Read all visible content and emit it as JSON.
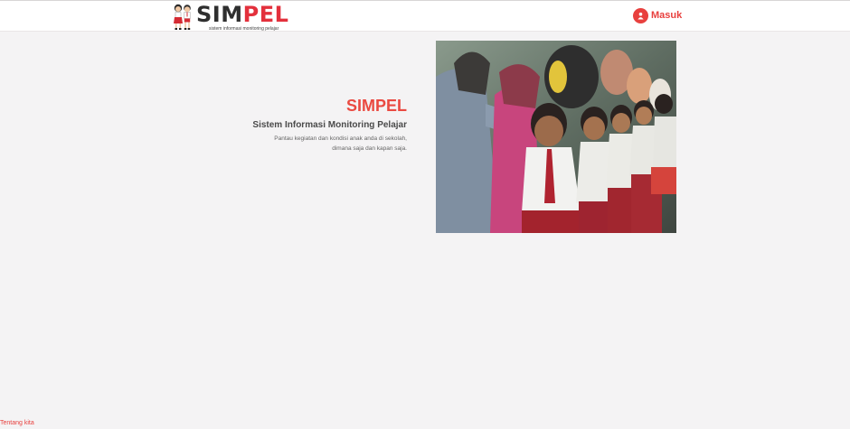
{
  "header": {
    "logo_sim": "SIM",
    "logo_pel": "PEL",
    "logo_tagline": "sistem informasi monitoring pelajar",
    "login_label": "Masuk"
  },
  "hero": {
    "title": "SIMPEL",
    "subtitle": "Sistem Informasi Monitoring Pelajar",
    "desc_line1": "Pantau kegiatan dan kondisi anak anda di sekolah,",
    "desc_line2": "dimana saja dan kapan saja."
  },
  "footer": {
    "link": "Tentang kita"
  },
  "colors": {
    "accent": "#e8403e",
    "background": "#f4f3f4",
    "header": "#ffffff"
  },
  "icons": {
    "login": "user-icon",
    "logo": "students-logo-icon"
  }
}
